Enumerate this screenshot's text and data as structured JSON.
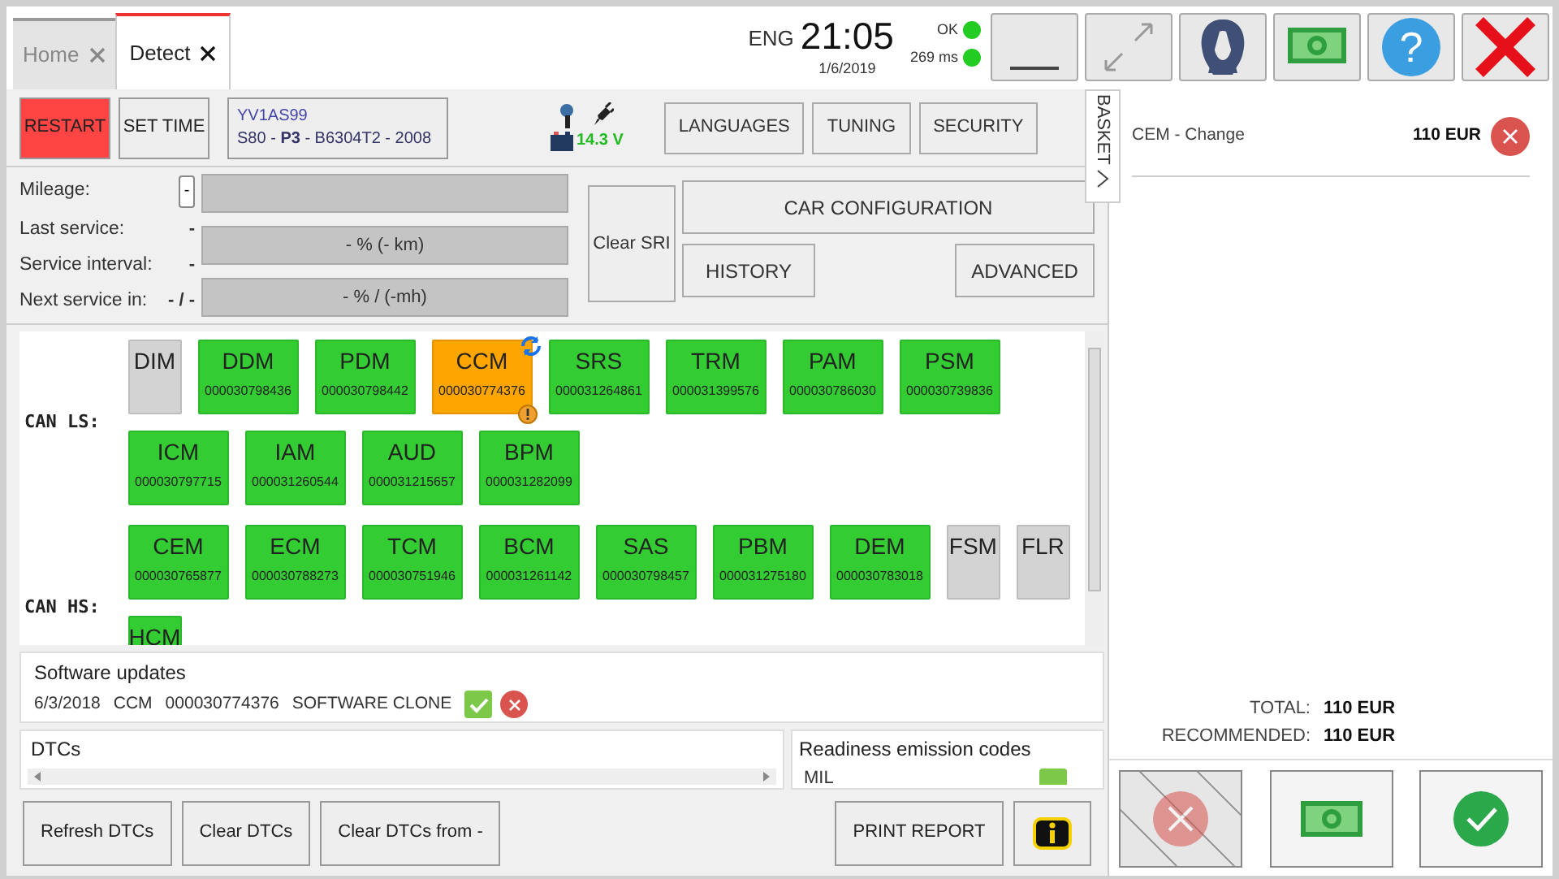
{
  "tabs": [
    {
      "label": "Home",
      "selected": false
    },
    {
      "label": "Detect",
      "selected": true
    }
  ],
  "header": {
    "language": "ENG",
    "time": "21:05",
    "date": "1/6/2019",
    "status": [
      {
        "label": "OK",
        "color": "#22cc22"
      },
      {
        "label": "269 ms",
        "color": "#22cc22"
      }
    ]
  },
  "window_buttons": [
    {
      "kind": "minimize"
    },
    {
      "kind": "maximize"
    },
    {
      "kind": "account"
    },
    {
      "kind": "payment"
    },
    {
      "kind": "help",
      "label": "?"
    },
    {
      "kind": "close"
    }
  ],
  "toolbar": {
    "restart": "RESTART",
    "set_time": "SET TIME",
    "vin": "YV1AS99",
    "vehicle": "S80 - **P3** - B6304T2 - 2008",
    "voltage": "14.3 V",
    "buttons": [
      "LANGUAGES",
      "TUNING",
      "SECURITY"
    ]
  },
  "basket_tab": "BASKET",
  "service": {
    "fields": [
      {
        "label": "Mileage:",
        "value": "-",
        "kind": "button"
      },
      {
        "label": "Last service:",
        "value": "-",
        "kind": "text"
      },
      {
        "label": "Service interval:",
        "value": "-",
        "kind": "text"
      },
      {
        "label": "Next service in:",
        "value": "- / -",
        "kind": "text"
      }
    ],
    "bars": [
      {
        "kind": "blank",
        "level": 0
      },
      {
        "kind": "reading",
        "text": "- % (- km)",
        "level": 0
      },
      {
        "kind": "reading",
        "text": "- % / (-mh)",
        "level": 0
      }
    ],
    "clear_sri": "Clear SRI",
    "car_configuration": "CAR CONFIGURATION",
    "history": "HISTORY",
    "advanced": "ADVANCED"
  },
  "buses": [
    {
      "label": "CAN LS:",
      "modules": [
        {
          "name": "DIM",
          "color": "#d3d3d3",
          "warning": false
        },
        {
          "name": "DDM",
          "serial": "000030798436",
          "color": "#33cc33",
          "warning": false
        },
        {
          "name": "PDM",
          "serial": "000030798442",
          "color": "#33cc33",
          "warning": false
        },
        {
          "name": "CCM",
          "serial": "000030774376",
          "color": "#ffa500",
          "warning": true
        },
        {
          "name": "SRS",
          "serial": "000031264861",
          "color": "#33cc33",
          "warning": false
        },
        {
          "name": "TRM",
          "serial": "000031399576",
          "color": "#33cc33",
          "warning": false
        },
        {
          "name": "PAM",
          "serial": "000030786030",
          "color": "#33cc33",
          "warning": false
        },
        {
          "name": "PSM",
          "serial": "000030739836",
          "color": "#33cc33",
          "warning": false
        },
        {
          "name": "ICM",
          "serial": "000030797715",
          "color": "#33cc33",
          "warning": false
        },
        {
          "name": "IAM",
          "serial": "000031260544",
          "color": "#33cc33",
          "warning": false
        },
        {
          "name": "AUD",
          "serial": "000031215657",
          "color": "#33cc33",
          "warning": false
        },
        {
          "name": "BPM",
          "serial": "000031282099",
          "color": "#33cc33",
          "warning": false
        }
      ]
    },
    {
      "label": "CAN HS:",
      "modules": [
        {
          "name": "CEM",
          "serial": "000030765877",
          "color": "#33cc33",
          "warning": false
        },
        {
          "name": "ECM",
          "serial": "000030788273",
          "color": "#33cc33",
          "warning": false
        },
        {
          "name": "TCM",
          "serial": "000030751946",
          "color": "#33cc33",
          "warning": false
        },
        {
          "name": "BCM",
          "serial": "000031261142",
          "color": "#33cc33",
          "warning": false
        },
        {
          "name": "SAS",
          "serial": "000030798457",
          "color": "#33cc33",
          "warning": false
        },
        {
          "name": "PBM",
          "serial": "000031275180",
          "color": "#33cc33",
          "warning": false
        },
        {
          "name": "DEM",
          "serial": "000030783018",
          "color": "#33cc33",
          "warning": false
        },
        {
          "name": "FSM",
          "color": "#d3d3d3",
          "warning": false
        },
        {
          "name": "FLR",
          "color": "#d3d3d3",
          "warning": false
        },
        {
          "name": "HCM",
          "color": "#33cc33",
          "warning": false
        }
      ]
    }
  ],
  "software_updates": {
    "title": "Software updates",
    "rows": [
      {
        "date": "6/3/2018",
        "module": "CCM",
        "serial": "000030774376",
        "action": "SOFTWARE CLONE"
      }
    ]
  },
  "dtcs": {
    "title": "DTCs"
  },
  "readiness": {
    "title": "Readiness emission codes",
    "rows": [
      {
        "label": "MIL",
        "checked": true
      }
    ]
  },
  "bottom_buttons": [
    {
      "kind": "action",
      "label": "Refresh DTCs"
    },
    {
      "kind": "action",
      "label": "Clear DTCs"
    },
    {
      "kind": "action",
      "label": "Clear DTCs from -"
    },
    {
      "kind": "report",
      "label": "PRINT REPORT"
    },
    {
      "kind": "info"
    }
  ],
  "basket": {
    "items": [
      {
        "label": "CEM - Change",
        "price": "110 EUR"
      }
    ],
    "total_label": "TOTAL:",
    "total": "110 EUR",
    "recommended_label": "RECOMMENDED:",
    "recommended": "110 EUR",
    "actions": [
      {
        "kind": "cancel",
        "disabled": true
      },
      {
        "kind": "pay",
        "disabled": false
      },
      {
        "kind": "confirm",
        "disabled": false
      }
    ]
  }
}
